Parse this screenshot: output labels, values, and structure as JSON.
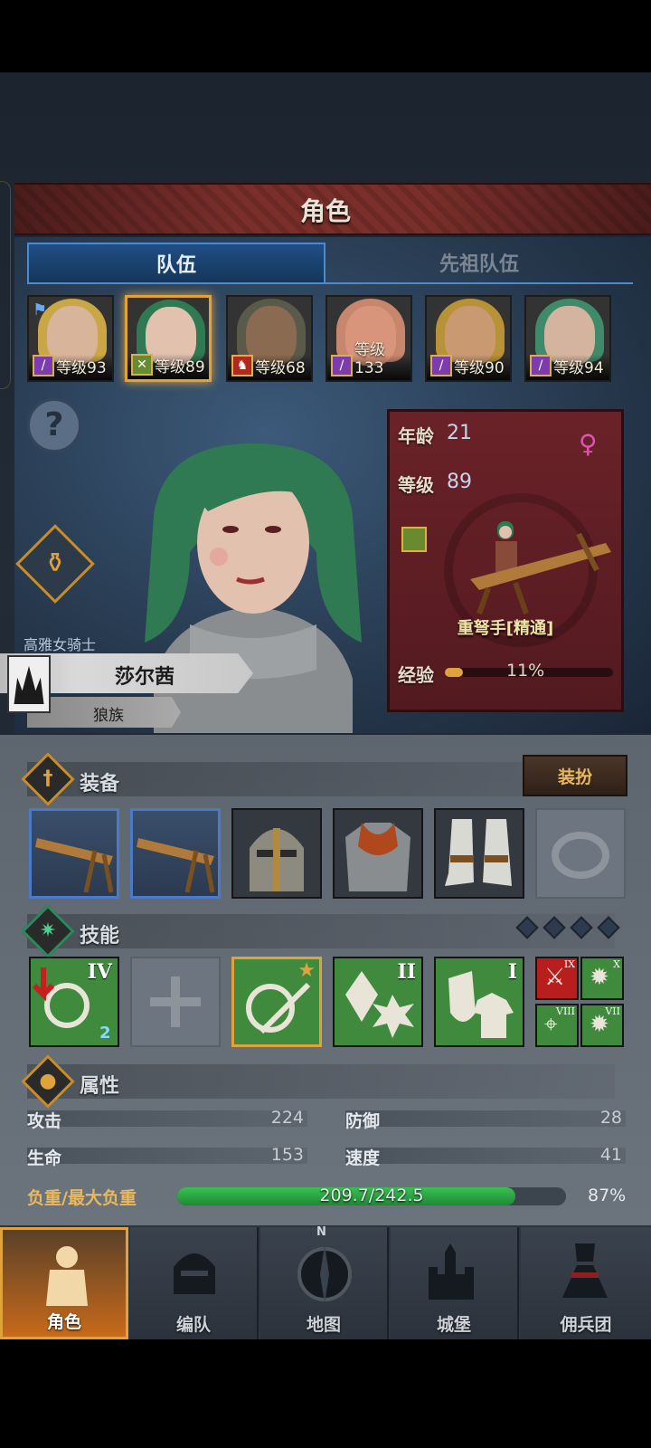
{
  "header": {
    "title": "角色"
  },
  "tabs": [
    {
      "label": "队伍",
      "active": true
    },
    {
      "label": "先祖队伍",
      "active": false
    }
  ],
  "party": [
    {
      "level": "等级93",
      "leader": true,
      "skin": "#d8b59a",
      "hair": "#c9a646"
    },
    {
      "level": "等级89",
      "selected": true,
      "skin": "#e2c1ae",
      "hair": "#2f7a52"
    },
    {
      "level": "等级68",
      "skin": "#8a6a50",
      "hair": "#5a5a4a"
    },
    {
      "level": "等级133",
      "skin": "#d8957c",
      "hair": "#c7866e"
    },
    {
      "level": "等级90",
      "skin": "#c99a72",
      "hair": "#b89236"
    },
    {
      "level": "等级94",
      "skin": "#d4b49e",
      "hair": "#3f8a6a"
    }
  ],
  "character": {
    "title": "高雅女骑士",
    "name": "莎尔茜",
    "race": "狼族",
    "age_label": "年龄",
    "age": "21",
    "level_label": "等级",
    "level": "89",
    "gender_symbol": "♀",
    "class_name": "重弩手[精通]",
    "exp_label": "经验",
    "exp_value": "11%",
    "exp_fraction": 0.11
  },
  "equipment": {
    "title": "装备",
    "dress_label": "装扮",
    "slots": [
      "crossbow",
      "crossbow",
      "helmet",
      "chest-armor",
      "boots",
      "ring-empty"
    ]
  },
  "skills": {
    "title": "技能",
    "items": [
      {
        "roman": "IV",
        "badge": "2"
      },
      {
        "roman": ""
      },
      {
        "roman": "",
        "star": true
      },
      {
        "roman": "II"
      },
      {
        "roman": "I"
      }
    ],
    "minis": [
      "IX",
      "X",
      "VIII",
      "VII"
    ]
  },
  "attributes": {
    "title": "属性",
    "attack_label": "攻击",
    "attack": "224",
    "defense_label": "防御",
    "defense": "28",
    "hp_label": "生命",
    "hp": "153",
    "speed_label": "速度",
    "speed": "41",
    "load_label": "负重/最大负重",
    "load_value": "209.7/242.5",
    "load_percent": "87%",
    "load_fraction": 0.87
  },
  "nav": [
    {
      "label": "角色",
      "active": true
    },
    {
      "label": "编队"
    },
    {
      "label": "地图",
      "compass": "N"
    },
    {
      "label": "城堡"
    },
    {
      "label": "佣兵团"
    }
  ],
  "colors": {
    "accent": "#e0a23a",
    "panel_blue": "#26384d",
    "banner_red": "#6a2228",
    "load_green": "#3ac052"
  }
}
